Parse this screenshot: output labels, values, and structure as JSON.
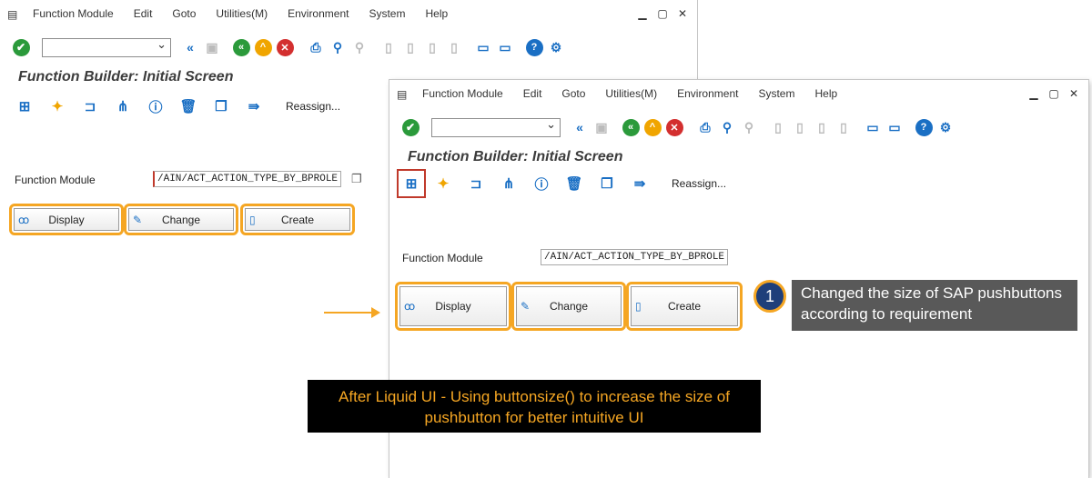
{
  "menu": [
    "Function Module",
    "Edit",
    "Goto",
    "Utilities(M)",
    "Environment",
    "System",
    "Help"
  ],
  "page_title": "Function Builder: Initial Screen",
  "app_toolbar": {
    "reassign_label": "Reassign..."
  },
  "function_module": {
    "label": "Function Module",
    "value": "/AIN/ACT_ACTION_TYPE_BY_BPROLE"
  },
  "buttons": {
    "display": "Display",
    "change": "Change",
    "create": "Create"
  },
  "callout": {
    "number": "1",
    "text": "Changed the size of SAP pushbuttons according to requirement"
  },
  "caption": {
    "text": "After Liquid UI - Using buttonsize() to increase the size of pushbutton for better  intuitive UI"
  },
  "colors": {
    "highlight": "#f5a623",
    "ok": "#2b9a3b",
    "back": "#2b9a3b",
    "exit": "#f0a500",
    "cancel": "#d32f2f",
    "help": "#1a6fc4",
    "callout_bg": "#595959",
    "badge": "#1f3f7a"
  }
}
